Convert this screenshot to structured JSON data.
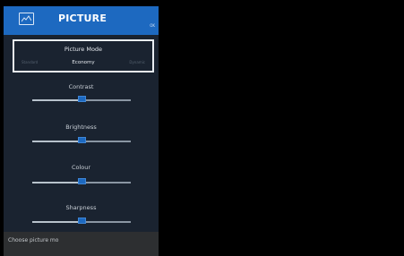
{
  "header": {
    "title": "PICTURE",
    "corner_mark": "OK",
    "icon": "picture-icon",
    "color": "#1d69c0"
  },
  "picture_mode": {
    "label": "Picture Mode",
    "value": "Economy",
    "prev_hint": "Standard",
    "next_hint": "Dynamic"
  },
  "sliders": [
    {
      "label": "Contrast",
      "level": 0.5
    },
    {
      "label": "Brightness",
      "level": 0.5
    },
    {
      "label": "Colour",
      "level": 0.5
    },
    {
      "label": "Sharpness",
      "level": 0.5
    }
  ],
  "footer": {
    "help_text": "Choose picture mo"
  }
}
